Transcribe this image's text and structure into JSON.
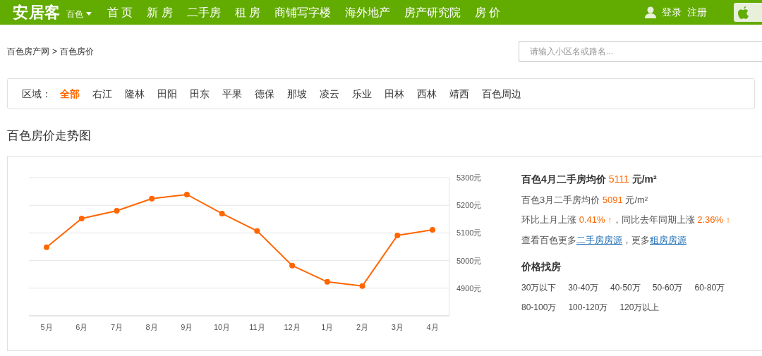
{
  "header": {
    "logo": "安居客",
    "city": "百色",
    "nav": [
      "首 页",
      "新 房",
      "二手房",
      "租 房",
      "商铺写字楼",
      "海外地产",
      "房产研究院",
      "房 价"
    ],
    "login": "登录",
    "register": "注册"
  },
  "breadcrumb": [
    "百色房产网",
    "百色房价"
  ],
  "breadcrumb_separator": ">",
  "search": {
    "placeholder": "请输入小区名或路名..."
  },
  "region_filter": {
    "label": "区域：",
    "options": [
      {
        "label": "全部",
        "selected": true
      },
      {
        "label": "右江",
        "selected": false
      },
      {
        "label": "隆林",
        "selected": false
      },
      {
        "label": "田阳",
        "selected": false
      },
      {
        "label": "田东",
        "selected": false
      },
      {
        "label": "平果",
        "selected": false
      },
      {
        "label": "德保",
        "selected": false
      },
      {
        "label": "那坡",
        "selected": false
      },
      {
        "label": "凌云",
        "selected": false
      },
      {
        "label": "乐业",
        "selected": false
      },
      {
        "label": "田林",
        "selected": false
      },
      {
        "label": "西林",
        "selected": false
      },
      {
        "label": "靖西",
        "selected": false
      },
      {
        "label": "百色周边",
        "selected": false
      }
    ]
  },
  "section_title": "百色房价走势图",
  "chart_data": {
    "type": "line",
    "categories": [
      "5月",
      "6月",
      "7月",
      "8月",
      "9月",
      "10月",
      "11月",
      "12月",
      "1月",
      "2月",
      "3月",
      "4月"
    ],
    "grid": true,
    "series": [
      {
        "color": "#ff6600",
        "marker": true,
        "values": [
          5048,
          5152,
          5180,
          5224,
          5239,
          5170,
          5107,
          4982,
          4923,
          4908,
          5091,
          5111
        ]
      }
    ],
    "ylim": [
      4800,
      5300
    ],
    "yticks": [
      {
        "value": 4900,
        "label": "4900元"
      },
      {
        "value": 5000,
        "label": "5000元"
      },
      {
        "value": 5100,
        "label": "5100元"
      },
      {
        "value": 5200,
        "label": "5200元"
      },
      {
        "value": 5300,
        "label": "5300元"
      }
    ]
  },
  "summary": {
    "current": {
      "label": "百色4月二手房均价",
      "value": "5111",
      "unit": "元/m²"
    },
    "previous": {
      "label": "百色3月二手房均价",
      "value": "5091",
      "unit": "元/m²"
    },
    "change": {
      "mom_label": "环比上月上涨",
      "mom_value": "0.41%",
      "mom_arrow": "↑",
      "yoy_label": "，同比去年同期上涨",
      "yoy_value": "2.36%",
      "yoy_arrow": "↑"
    },
    "more": {
      "prefix": "查看百色更多",
      "link1": "二手房房源",
      "middle": "，更多",
      "link2": "租房房源"
    }
  },
  "price_search": {
    "title": "价格找房",
    "options": [
      "30万以下",
      "30-40万",
      "40-50万",
      "50-60万",
      "60-80万",
      "80-100万",
      "100-120万",
      "120万以上"
    ]
  }
}
